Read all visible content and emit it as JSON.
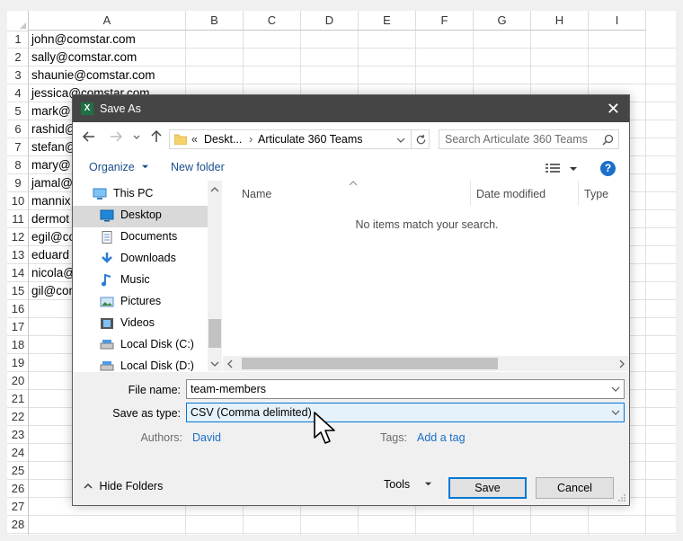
{
  "sheet": {
    "columns": [
      "A",
      "B",
      "C",
      "D",
      "E",
      "F",
      "G",
      "H",
      "I"
    ],
    "rows": [
      "1",
      "2",
      "3",
      "4",
      "5",
      "6",
      "7",
      "8",
      "9",
      "10",
      "11",
      "12",
      "13",
      "14",
      "15",
      "16",
      "17",
      "18",
      "19",
      "20",
      "21",
      "22",
      "23",
      "24",
      "25",
      "26",
      "27",
      "28"
    ],
    "cells": [
      "john@comstar.com",
      "sally@comstar.com",
      "shaunie@comstar.com",
      "jessica@comstar.com",
      "mark@",
      "rashid@",
      "stefan@",
      "mary@",
      "jamal@",
      "mannix",
      "dermot",
      "egil@co",
      "eduard",
      "nicola@",
      "gil@com"
    ]
  },
  "dialog": {
    "title": "Save As",
    "app_icon": "X",
    "nav": {
      "back_icon": "arrow-left",
      "forward_icon": "arrow-right",
      "recent_icon": "chevron-down",
      "up_icon": "arrow-up",
      "refresh_icon": "refresh"
    },
    "address": {
      "prefix": "«",
      "segment1": "Deskt...",
      "separator": "›",
      "segment2": "Articulate 360 Teams"
    },
    "search_placeholder": "Search Articulate 360 Teams",
    "organize_label": "Organize",
    "new_folder_label": "New folder",
    "help_label": "?",
    "tree": [
      {
        "label": "This PC",
        "icon": "computer-icon"
      },
      {
        "label": "Desktop",
        "icon": "desktop-icon",
        "selected": true
      },
      {
        "label": "Documents",
        "icon": "documents-icon"
      },
      {
        "label": "Downloads",
        "icon": "downloads-icon"
      },
      {
        "label": "Music",
        "icon": "music-icon"
      },
      {
        "label": "Pictures",
        "icon": "pictures-icon"
      },
      {
        "label": "Videos",
        "icon": "videos-icon"
      },
      {
        "label": "Local Disk (C:)",
        "icon": "disk-icon"
      },
      {
        "label": "Local Disk (D:)",
        "icon": "disk-icon"
      }
    ],
    "columns": {
      "name": "Name",
      "date": "Date modified",
      "type": "Type"
    },
    "empty_message": "No items match your search.",
    "file_name_label": "File name:",
    "file_name_value": "team-members",
    "save_type_label": "Save as type:",
    "save_type_value": "CSV (Comma delimited)",
    "authors_label": "Authors:",
    "authors_value": "David",
    "tags_label": "Tags:",
    "tags_value": "Add a tag",
    "hide_folders_label": "Hide Folders",
    "tools_label": "Tools",
    "save_label": "Save",
    "cancel_label": "Cancel"
  },
  "colors": {
    "titlebar": "#454545",
    "accent": "#0078d7",
    "link": "#1a6fc8",
    "excel_green": "#1e7145"
  }
}
